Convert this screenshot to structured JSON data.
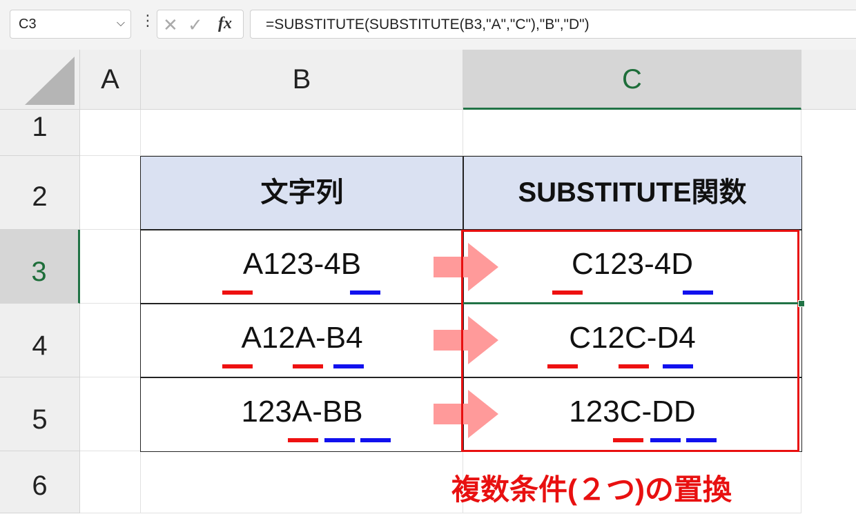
{
  "formula_bar": {
    "name_box": "C3",
    "name_box_chevron": "⌵",
    "dots": "⋮",
    "cancel": "✕",
    "enter": "✓",
    "function": "fx",
    "formula": "=SUBSTITUTE(SUBSTITUTE(B3,\"A\",\"C\"),\"B\",\"D\")"
  },
  "columns": [
    "A",
    "B",
    "C"
  ],
  "rows": [
    "1",
    "2",
    "3",
    "4",
    "5",
    "6"
  ],
  "table": {
    "header_b": "文字列",
    "header_c": "SUBSTITUTE関数",
    "b_values": [
      "A123-4B",
      "A12A-B4",
      "123A-BB"
    ],
    "c_values": [
      "C123-4D",
      "C12C-D4",
      "123C-DD"
    ]
  },
  "caption": "複数条件(２つ)の置換",
  "colors": {
    "header_fill": "#dae1f2",
    "highlight_border": "#e81010",
    "arrow_fill": "#ff9a9a",
    "underline_red": "#ee1111",
    "underline_blue": "#1111ee",
    "selection_green": "#217346"
  }
}
